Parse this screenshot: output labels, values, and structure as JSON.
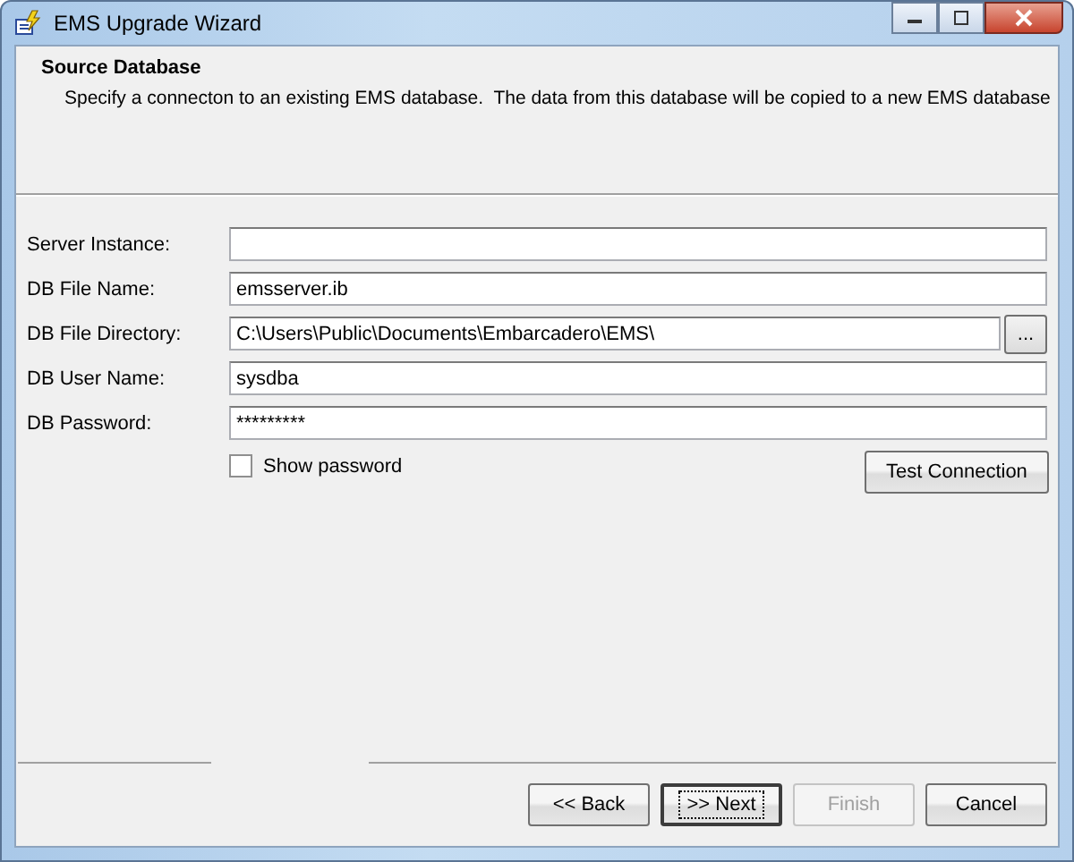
{
  "window": {
    "title": "EMS Upgrade Wizard"
  },
  "header": {
    "title": "Source Database",
    "description": "Specify a connecton to an existing EMS database.  The data from this database will be copied to a new EMS database"
  },
  "fields": [
    {
      "label": "Server Instance:"
    },
    {
      "label": "DB File Name:",
      "value": "emsserver.ib"
    },
    {
      "label": "DB File Directory:",
      "value": "C:\\Users\\Public\\Documents\\Embarcadero\\EMS\\",
      "browse_label": "..."
    },
    {
      "label": "DB User Name:",
      "value": "sysdba"
    },
    {
      "label": "DB Password:",
      "value": "*********"
    }
  ],
  "show_password": {
    "label": "Show password",
    "checked": false
  },
  "test_button": "Test Connection",
  "buttons": [
    {
      "label": "<< Back",
      "disabled": false,
      "default": false
    },
    {
      "label": ">> Next",
      "disabled": false,
      "default": true
    },
    {
      "label": "Finish",
      "disabled": true,
      "default": false
    },
    {
      "label": "Cancel",
      "disabled": false,
      "default": false
    }
  ]
}
